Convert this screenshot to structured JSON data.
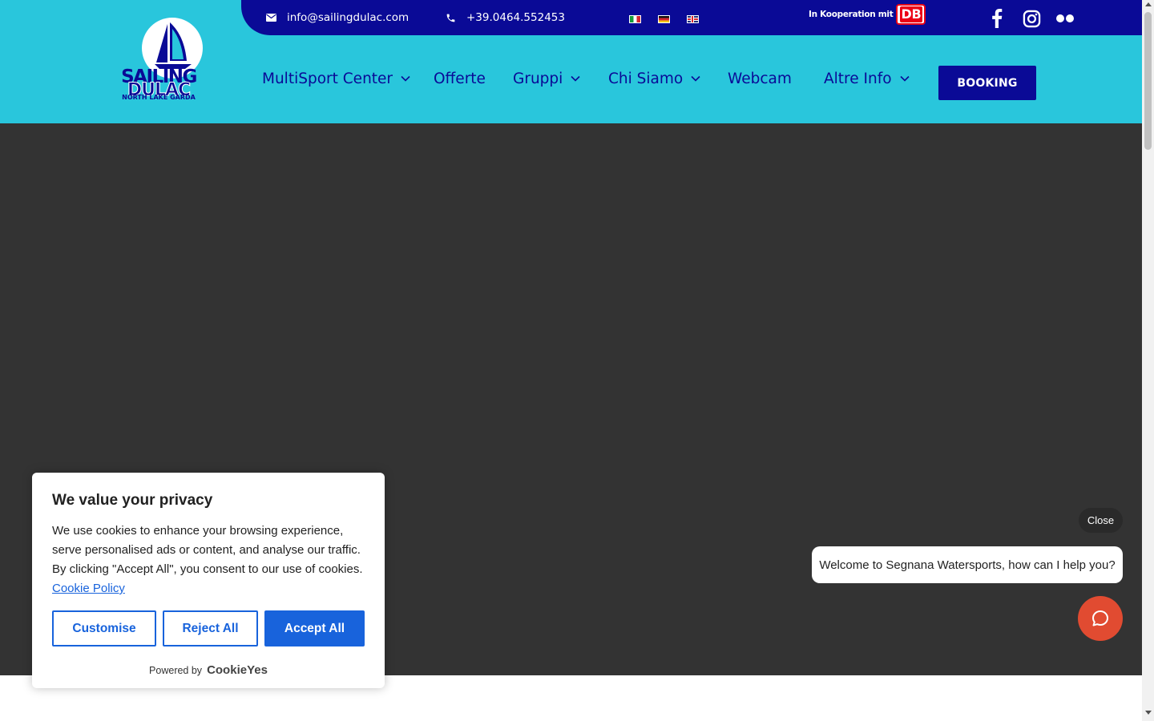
{
  "topbar": {
    "email": "info@sailingdulac.com",
    "phone": "+39.0464.552453",
    "cooperation_text": "In Kooperation mit",
    "db_logo_text": "DB",
    "languages": [
      "it-flag",
      "de-flag",
      "en-flag"
    ]
  },
  "logo": {
    "line1": "SAILING",
    "line2": "DULAC",
    "line3": "NORTH LAKE GARDA"
  },
  "nav": {
    "items": [
      {
        "label": "MultiSport Center",
        "has_dropdown": true
      },
      {
        "label": "Offerte",
        "has_dropdown": false
      },
      {
        "label": "Gruppi",
        "has_dropdown": true
      },
      {
        "label": "Chi Siamo",
        "has_dropdown": true
      },
      {
        "label": "Webcam",
        "has_dropdown": false
      },
      {
        "label": "Altre Info",
        "has_dropdown": true
      }
    ],
    "booking_label": "BOOKING"
  },
  "social": [
    "facebook-icon",
    "instagram-icon",
    "flickr-icon"
  ],
  "cookie": {
    "title": "We value your privacy",
    "text": "We use cookies to enhance your browsing experience, serve personalised ads or content, and analyse our traffic. By clicking \"Accept All\", you consent to our use of cookies.",
    "policy_link": "Cookie Policy",
    "customise": "Customise",
    "reject": "Reject All",
    "accept": "Accept All",
    "powered_by": "Powered by",
    "brand": "CookieYes"
  },
  "chat": {
    "close_label": "Close",
    "welcome": "Welcome to Segnana Watersports, how can I help you?"
  },
  "colors": {
    "header_cyan": "#29c6dc",
    "navy": "#0a0a96",
    "hero_dark": "#333333",
    "cookie_blue": "#1863dc",
    "chat_orange": "#e14b31"
  }
}
